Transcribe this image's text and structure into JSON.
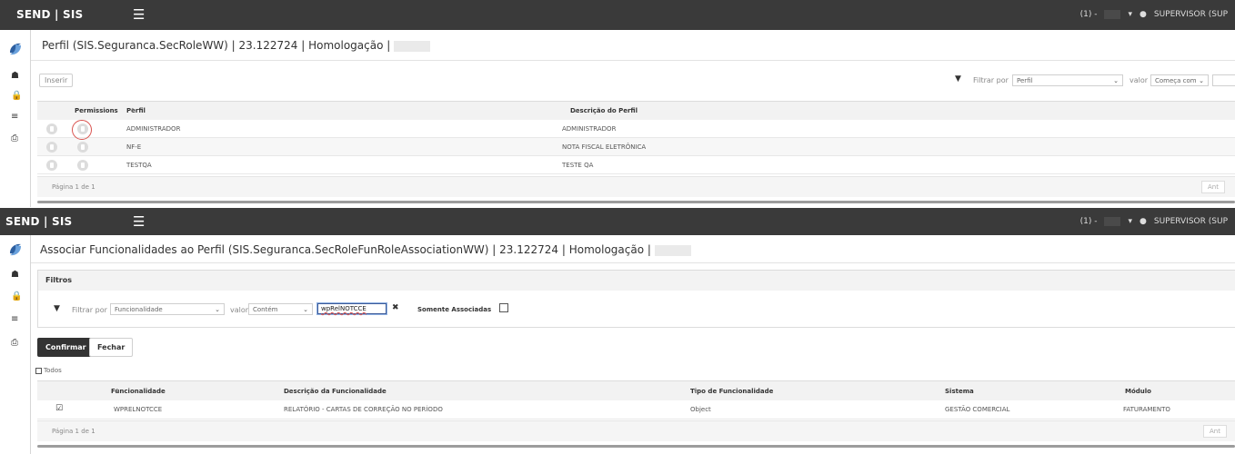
{
  "top": {
    "brand": "SEND | SIS",
    "notif": "(1) -",
    "user": "SUPERVISOR (SUP",
    "user_bottom": "SUPERVISOR (SUP"
  },
  "screen1": {
    "title": "Perfil (SIS.Seguranca.SecRoleWW) | 23.122724 | Homologação |",
    "insert_button": "Inserir",
    "filter_by": "Filtrar por",
    "filter_field": "Perfil",
    "value_label": "valor",
    "value_op": "Começa com",
    "columns": [
      "Permissions",
      "Perfil",
      "Descrição do Perfil"
    ],
    "sort_up": "↑",
    "sort_dd": "▾",
    "rows": [
      {
        "perfil": "ADMINISTRADOR",
        "descricao": "ADMINISTRADOR"
      },
      {
        "perfil": "NF-E",
        "descricao": "NOTA FISCAL ELETRÔNICA"
      },
      {
        "perfil": "TESTQA",
        "descricao": "TESTE QA"
      }
    ],
    "pager": "Página 1 de 1",
    "prev": "Ant"
  },
  "screen2": {
    "title": "Associar Funcionalidades ao Perfil (SIS.Seguranca.SecRoleFunRoleAssociationWW) | 23.122724 | Homologação |",
    "filters_title": "Filtros",
    "filter_by": "Filtrar por",
    "filter_field": "Funcionalidade",
    "value_label": "valor",
    "value_op": "Contém",
    "search_value": "wpRelNOTCCE",
    "only_assoc": "Somente Associadas",
    "confirm": "Confirmar",
    "close": "Fechar",
    "all": "Todos",
    "columns": [
      "Funcionalidade",
      "Descrição da Funcionalidade",
      "Tipo de Funcionalidade",
      "Sistema",
      "Módulo"
    ],
    "rows": [
      {
        "func": "WPRELNOTCCE",
        "desc": "RELATÓRIO - CARTAS DE CORREÇÃO NO PERÍODO",
        "tipo": "Object",
        "sistema": "GESTÃO COMERCIAL",
        "modulo": "FATURAMENTO"
      }
    ],
    "pager": "Página 1 de 1",
    "prev": "Ant"
  },
  "icons": {
    "home": "home-icon",
    "lock": "lock-icon",
    "list": "list-icon",
    "print": "print-icon",
    "filter": "filter-icon",
    "user": "user-icon",
    "menu": "hamburger-icon"
  },
  "colors": {
    "topbar": "#3a3a3a",
    "accent_red": "#d9534f"
  }
}
